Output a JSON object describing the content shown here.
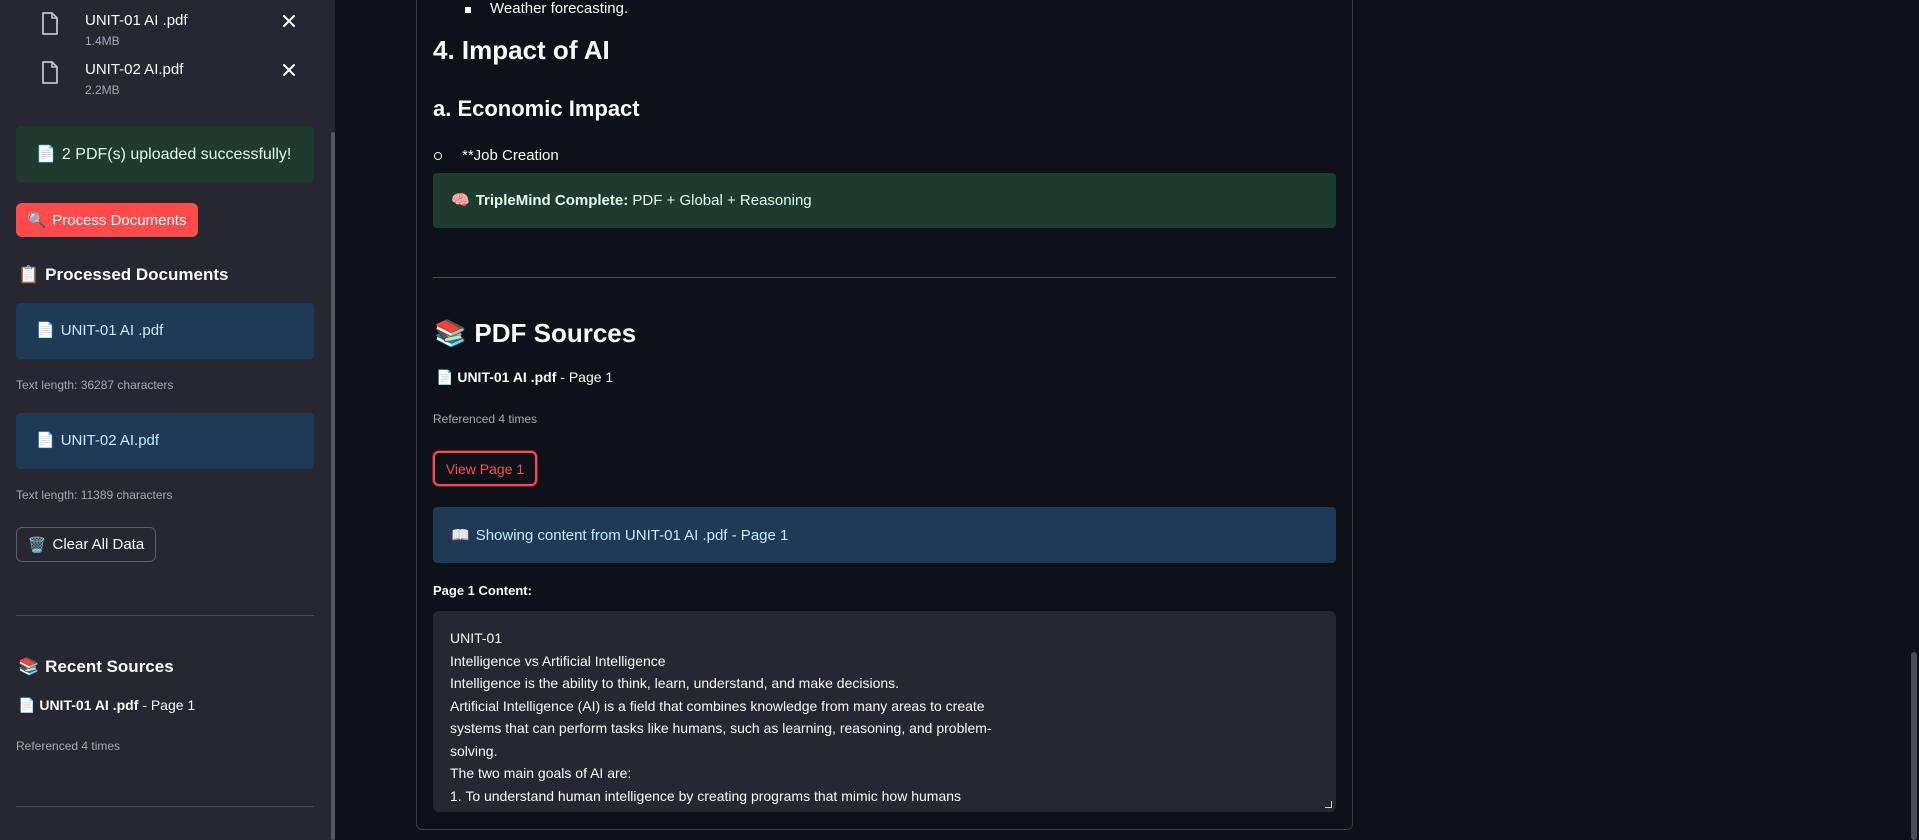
{
  "sidebar": {
    "files": [
      {
        "name": "UNIT-01 AI .pdf",
        "size": "1.4MB"
      },
      {
        "name": "UNIT-02 AI.pdf",
        "size": "2.2MB"
      }
    ],
    "upload_success": {
      "emoji": "📄",
      "text": "2 PDF(s) uploaded successfully!"
    },
    "process_button": {
      "emoji": "🔍",
      "label": "Process Documents"
    },
    "processed_heading": {
      "emoji": "📋",
      "text": "Processed Documents"
    },
    "processed_docs": [
      {
        "emoji": "📄",
        "name": "UNIT-01 AI .pdf",
        "meta": "Text length: 36287 characters"
      },
      {
        "emoji": "📄",
        "name": "UNIT-02 AI.pdf",
        "meta": "Text length: 11389 characters"
      }
    ],
    "clear_button": {
      "emoji": "🗑️",
      "label": "Clear All Data"
    },
    "recent_heading": {
      "emoji": "📚",
      "text": "Recent Sources"
    },
    "recent_source": {
      "emoji": "📄",
      "doc": "UNIT-01 AI .pdf",
      "page": " - Page 1",
      "meta": "Referenced 4 times"
    }
  },
  "main": {
    "bullet_text": "Weather forecasting.",
    "h_impact": "4. Impact of AI",
    "h_economic": "a. Economic Impact",
    "job_item": "**Job Creation",
    "triplemind": {
      "emoji": "🧠",
      "bold": "TripleMind Complete:",
      "text": " PDF + Global + Reasoning"
    },
    "pdf_sources_heading": {
      "emoji": "📚",
      "text": "PDF Sources"
    },
    "source": {
      "emoji": "📄",
      "doc": "UNIT-01 AI .pdf",
      "page": " - Page 1",
      "meta": "Referenced 4 times"
    },
    "view_button": "View Page 1",
    "showing": {
      "emoji": "📖",
      "text": "Showing content from UNIT-01 AI .pdf - Page 1"
    },
    "content_label": "Page 1 Content:",
    "content_lines": [
      "UNIT-01",
      "Intelligence vs Artificial Intelligence",
      "Intelligence is the ability to think, learn, understand, and make decisions.",
      "Artificial Intelligence (AI) is a field that combines knowledge from many areas to create",
      "systems that can perform tasks like humans, such as learning, reasoning, and problem-",
      "solving.",
      "The two main goals of AI are:",
      "1. To understand human intelligence by creating programs that mimic how humans"
    ]
  },
  "colors": {
    "accent": "#ff4b4b",
    "success_bg": "#1d3c2f",
    "info_bg": "#1e3a56",
    "background": "#0e1117",
    "sidebar_bg": "#262730"
  }
}
